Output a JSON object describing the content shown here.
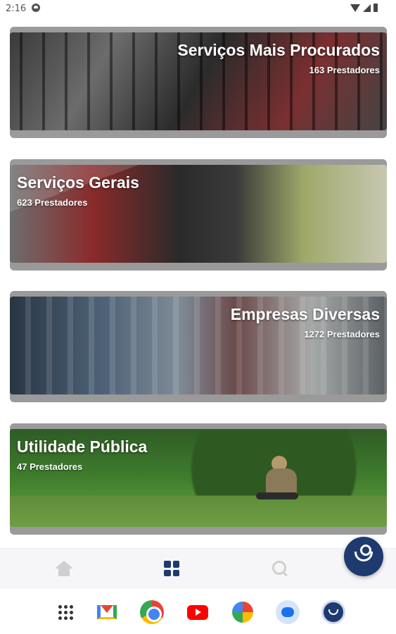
{
  "status_bar": {
    "time": "2:16"
  },
  "categories": [
    {
      "title": "Serviços Mais Procurados",
      "count": "163 Prestadores"
    },
    {
      "title": "Serviços Gerais",
      "count": "623 Prestadores"
    },
    {
      "title": "Empresas Diversas",
      "count": "1272 Prestadores"
    },
    {
      "title": "Utilidade Pública",
      "count": "47 Prestadores"
    }
  ],
  "bottom_nav": {
    "active": "categories",
    "active_color": "#1e3a6e",
    "inactive_color": "#cfcfcf"
  },
  "fab": {
    "icon": "hand-icon",
    "color": "#1e3a6e"
  },
  "dock": {
    "icons": [
      "apps-icon",
      "gmail-icon",
      "chrome-icon",
      "youtube-icon",
      "photos-icon",
      "messages-icon",
      "app-shortcut-icon"
    ]
  }
}
